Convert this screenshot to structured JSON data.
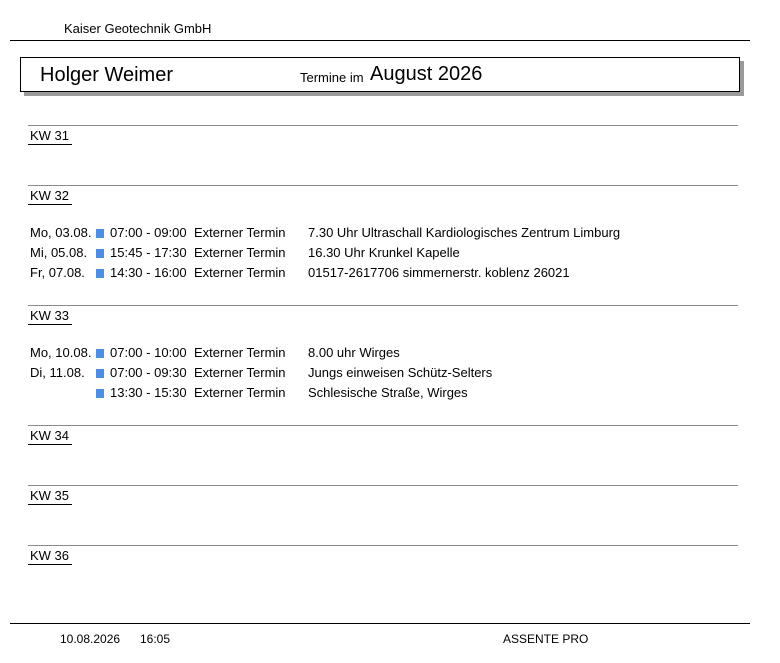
{
  "header": {
    "company": "Kaiser Geotechnik GmbH"
  },
  "title": {
    "person": "Holger Weimer",
    "label": "Termine im",
    "month": "August 2026"
  },
  "weeks": [
    {
      "label": "KW 31",
      "appointments": []
    },
    {
      "label": "KW 32",
      "appointments": [
        {
          "day": "Mo, 03.08.",
          "time": "07:00 - 09:00",
          "type": "Externer Termin",
          "desc": "7.30 Uhr Ultraschall Kardiologisches Zentrum Limburg"
        },
        {
          "day": "Mi,  05.08.",
          "time": "15:45 - 17:30",
          "type": "Externer Termin",
          "desc": "16.30 Uhr Krunkel Kapelle"
        },
        {
          "day": "Fr,  07.08.",
          "time": "14:30 - 16:00",
          "type": "Externer Termin",
          "desc": "01517-2617706 simmernerstr. koblenz 26021"
        }
      ]
    },
    {
      "label": "KW 33",
      "appointments": [
        {
          "day": "Mo, 10.08.",
          "time": "07:00 - 10:00",
          "type": "Externer Termin",
          "desc": "8.00 uhr Wirges"
        },
        {
          "day": "Di,  11.08.",
          "time": "07:00 - 09:30",
          "type": "Externer Termin",
          "desc": "Jungs einweisen Schütz-Selters"
        },
        {
          "day": "",
          "time": "13:30 - 15:30",
          "type": "Externer Termin",
          "desc": "Schlesische Straße, Wirges"
        }
      ]
    },
    {
      "label": "KW 34",
      "appointments": []
    },
    {
      "label": "KW 35",
      "appointments": []
    },
    {
      "label": "KW 36",
      "appointments": []
    }
  ],
  "footer": {
    "date": "10.08.2026",
    "time": "16:05",
    "app": "ASSENTE PRO"
  },
  "colors": {
    "marker": "#4a8ee8",
    "shadow": "#9a9a9a",
    "rule": "#8a8a8a"
  }
}
